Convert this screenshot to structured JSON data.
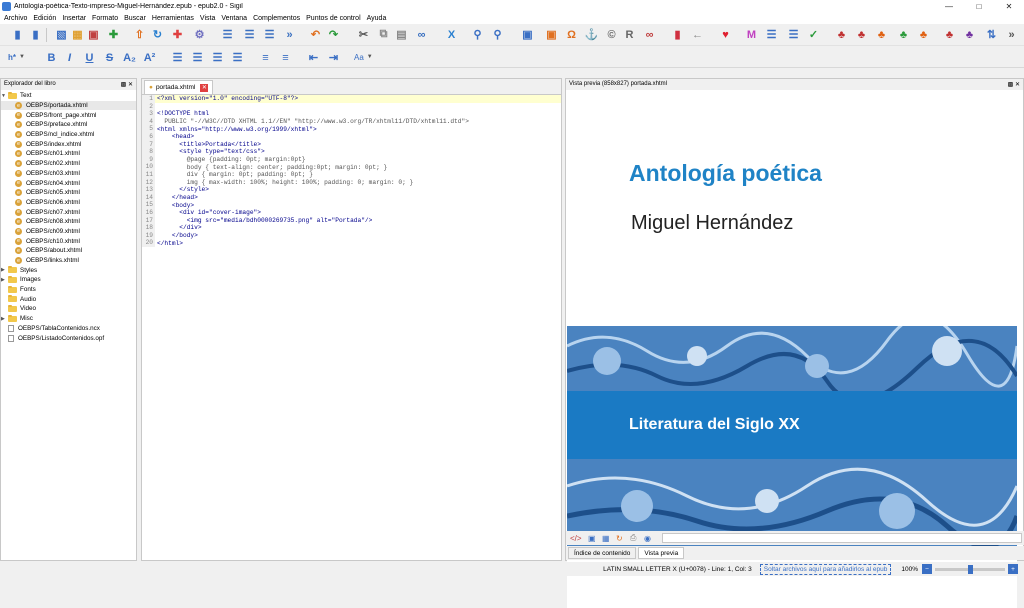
{
  "window": {
    "title": "Antología-poética-Texto-impreso-Miguel-Hernández.epub - epub2.0 - Sigil"
  },
  "menu": [
    "Archivo",
    "Edición",
    "Insertar",
    "Formato",
    "Buscar",
    "Herramientas",
    "Vista",
    "Ventana",
    "Complementos",
    "Puntos de control",
    "Ayuda"
  ],
  "toolbar2": {
    "heading_label": "h*",
    "case_label": "Aa"
  },
  "book_browser": {
    "title": "Explorador del libro",
    "text_folder": "Text",
    "files": [
      "OEBPS/portada.xhtml",
      "OEBPS/front_page.xhtml",
      "OEBPS/preface.xhtml",
      "OEBPS/ncl_indice.xhtml",
      "OEBPS/index.xhtml",
      "OEBPS/ch01.xhtml",
      "OEBPS/ch02.xhtml",
      "OEBPS/ch03.xhtml",
      "OEBPS/ch04.xhtml",
      "OEBPS/ch05.xhtml",
      "OEBPS/ch06.xhtml",
      "OEBPS/ch07.xhtml",
      "OEBPS/ch08.xhtml",
      "OEBPS/ch09.xhtml",
      "OEBPS/ch10.xhtml",
      "OEBPS/about.xhtml",
      "OEBPS/links.xhtml"
    ],
    "folders": [
      "Styles",
      "Images",
      "Fonts",
      "Audio",
      "Video",
      "Misc"
    ],
    "root_files": [
      "OEBPS/TablaContenidos.ncx",
      "OEBPS/ListadoContenidos.opf"
    ]
  },
  "editor": {
    "tab_label": "portada.xhtml",
    "lines": [
      "<?xml version=\"1.0\" encoding=\"UTF-8\"?>",
      "",
      "<!DOCTYPE html",
      "  PUBLIC \"-//W3C//DTD XHTML 1.1//EN\" \"http://www.w3.org/TR/xhtml11/DTD/xhtml11.dtd\">",
      "<html xmlns=\"http://www.w3.org/1999/xhtml\">",
      "    <head>",
      "      <title>Portada</title>",
      "      <style type=\"text/css\">",
      "        @page {padding: 0pt; margin:0pt}",
      "        body { text-align: center; padding:0pt; margin: 0pt; }",
      "        div { margin: 0pt; padding: 0pt; }",
      "        img { max-width: 100%; height: 100%; padding: 0; margin: 0; }",
      "      </style>",
      "    </head>",
      "    <body>",
      "      <div id=\"cover-image\">",
      "        <img src=\"media/bdh0000269735.png\" alt=\"Portada\"/>",
      "      </div>",
      "    </body>",
      "</html>"
    ],
    "line_numbers": [
      "1",
      "2",
      "3",
      "4",
      "5",
      "6",
      "7",
      "8",
      "9",
      "10",
      "11",
      "12",
      "13",
      "14",
      "15",
      "16",
      "17",
      "18",
      "19",
      "20"
    ]
  },
  "preview": {
    "title": "Vista previa (858x827) portada.xhtml",
    "book_title": "Antología poética",
    "author": "Miguel Hernández",
    "collection": "Literatura del Siglo XX",
    "tabs": [
      "Índice de contenido",
      "Vista previa"
    ]
  },
  "status": {
    "char_info": "LATIN SMALL LETTER X (U+0078) - Line: 1, Col: 3",
    "drop_hint": "Soltar archivos aquí para añadirlos al epub",
    "zoom": "100%"
  },
  "colors": {
    "title_blue": "#1f83c6",
    "band_blue": "#1a7ac4",
    "cover_blue": "#4a83c0"
  }
}
